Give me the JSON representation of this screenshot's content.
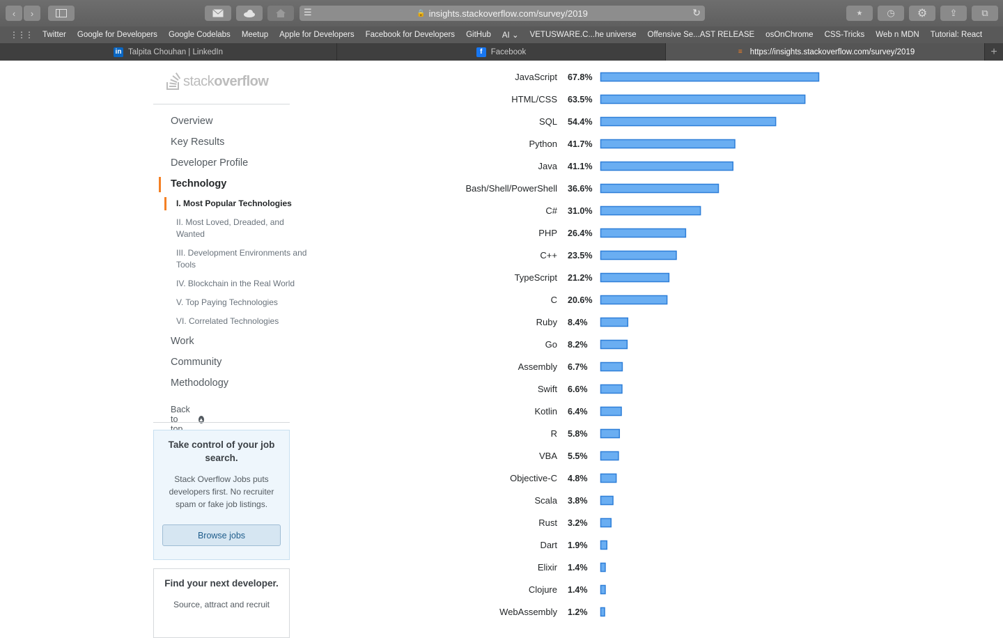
{
  "browser": {
    "url": "insights.stackoverflow.com/survey/2019",
    "bookmarks": [
      "Twitter",
      "Google for Developers",
      "Google Codelabs",
      "Meetup",
      "Apple for Developers",
      "Facebook for Developers",
      "GitHub",
      "AI",
      "VETUSWARE.C...he universe",
      "Offensive Se...AST RELEASE",
      "osOnChrome",
      "CSS-Tricks",
      "Web n MDN",
      "Tutorial: React"
    ],
    "tabs": [
      {
        "label": "Talpita Chouhan | LinkedIn",
        "icon": "linkedin-icon",
        "active": false
      },
      {
        "label": "Facebook",
        "icon": "facebook-icon",
        "active": false
      },
      {
        "label": "https://insights.stackoverflow.com/survey/2019",
        "icon": "stackoverflow-icon",
        "active": true
      }
    ]
  },
  "logo": {
    "light": "stack",
    "bold": "overflow"
  },
  "sidebar": {
    "nav": [
      "Overview",
      "Key Results",
      "Developer Profile",
      "Technology",
      "Work",
      "Community",
      "Methodology"
    ],
    "active": "Technology",
    "sub_items": [
      "I. Most Popular Technologies",
      "II. Most Loved, Dreaded, and Wanted",
      "III. Development Environments and Tools",
      "IV. Blockchain in the Real World",
      "V. Top Paying Technologies",
      "VI. Correlated Technologies"
    ],
    "back_to_top": "Back to top"
  },
  "promo_jobs": {
    "title": "Take control of your job search.",
    "body": "Stack Overflow Jobs puts developers first. No recruiter spam or fake job listings.",
    "button": "Browse jobs"
  },
  "promo_hire": {
    "title": "Find your next developer.",
    "body": "Source, attract and recruit"
  },
  "chart_data": {
    "type": "bar",
    "orientation": "horizontal",
    "bar_color": "#6aaef2",
    "bar_border": "#2f7fd8",
    "categories": [
      "JavaScript",
      "HTML/CSS",
      "SQL",
      "Python",
      "Java",
      "Bash/Shell/PowerShell",
      "C#",
      "PHP",
      "C++",
      "TypeScript",
      "C",
      "Ruby",
      "Go",
      "Assembly",
      "Swift",
      "Kotlin",
      "R",
      "VBA",
      "Objective-C",
      "Scala",
      "Rust",
      "Dart",
      "Elixir",
      "Clojure",
      "WebAssembly"
    ],
    "values": [
      67.8,
      63.5,
      54.4,
      41.7,
      41.1,
      36.6,
      31.0,
      26.4,
      23.5,
      21.2,
      20.6,
      8.4,
      8.2,
      6.7,
      6.6,
      6.4,
      5.8,
      5.5,
      4.8,
      3.8,
      3.2,
      1.9,
      1.4,
      1.4,
      1.2
    ],
    "value_labels": [
      "67.8%",
      "63.5%",
      "54.4%",
      "41.7%",
      "41.1%",
      "36.6%",
      "31.0%",
      "26.4%",
      "23.5%",
      "21.2%",
      "20.6%",
      "8.4%",
      "8.2%",
      "6.7%",
      "6.6%",
      "6.4%",
      "5.8%",
      "5.5%",
      "4.8%",
      "3.8%",
      "3.2%",
      "1.9%",
      "1.4%",
      "1.4%",
      "1.2%"
    ],
    "xlim": [
      0,
      100
    ],
    "grid": false
  }
}
